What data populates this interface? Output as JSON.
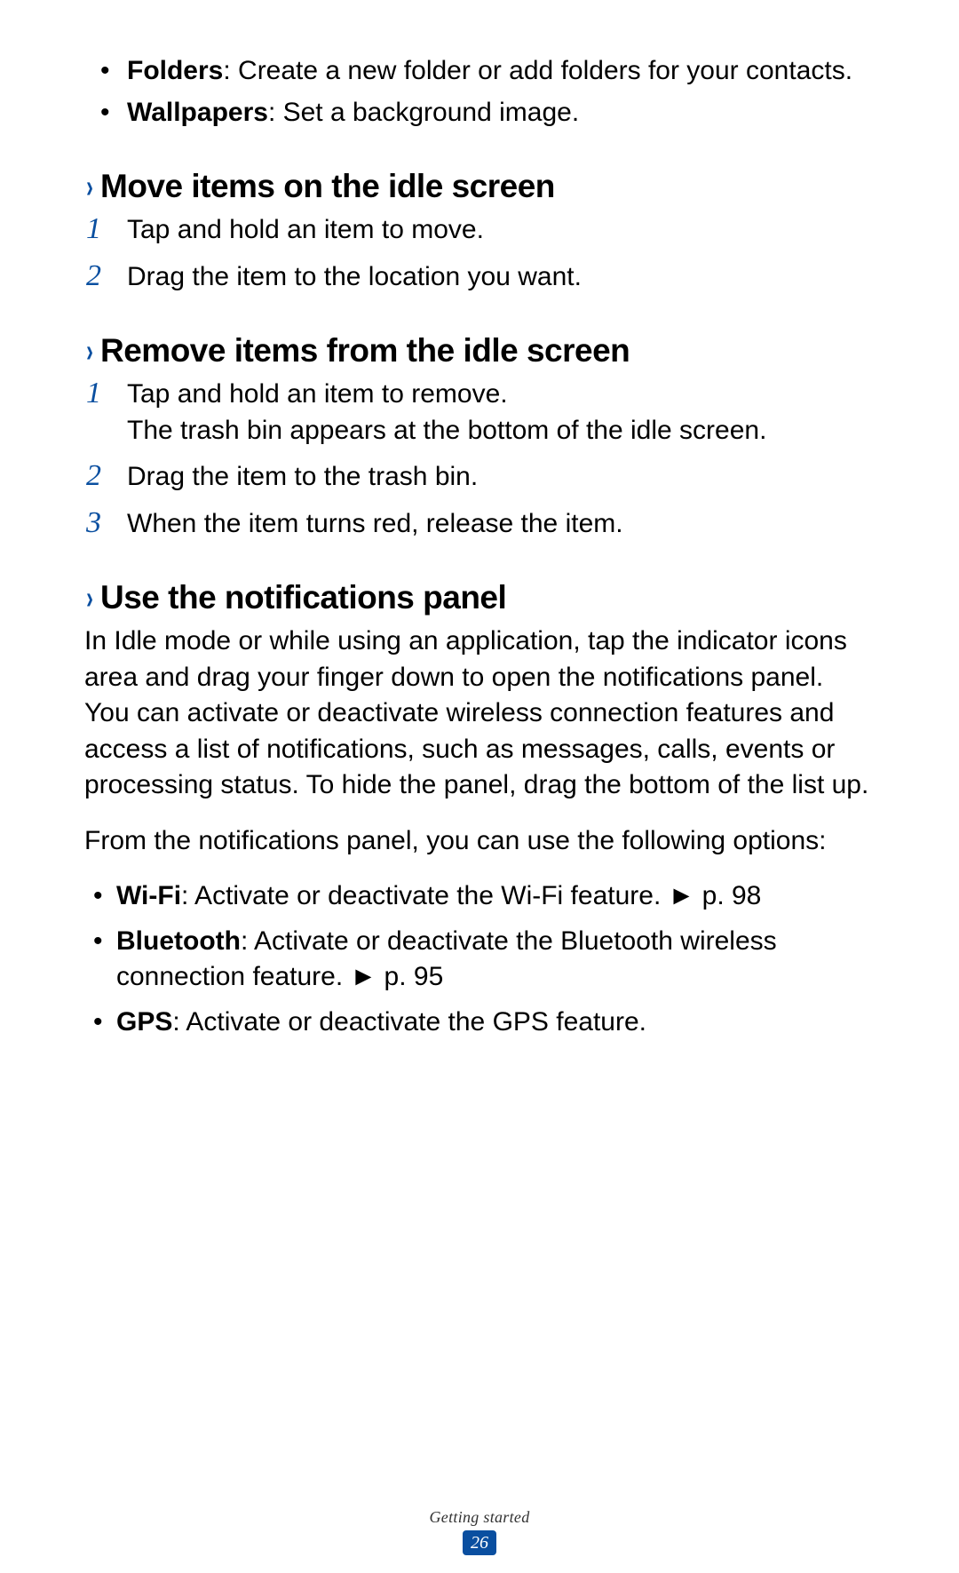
{
  "intro_bullets": [
    {
      "term": "Folders",
      "desc": ": Create a new folder or add folders for your contacts."
    },
    {
      "term": "Wallpapers",
      "desc": ": Set a background image."
    }
  ],
  "sections": {
    "move": {
      "heading": "Move items on the idle screen",
      "steps": [
        "Tap and hold an item to move.",
        "Drag the item to the location you want."
      ]
    },
    "remove": {
      "heading": "Remove items from the idle screen",
      "step1_line1": "Tap and hold an item to remove.",
      "step1_line2": "The trash bin appears at the bottom of the idle screen.",
      "step2": "Drag the item to the trash bin.",
      "step3": "When the item turns red, release the item."
    },
    "notifications": {
      "heading": "Use the notifications panel",
      "para1": "In Idle mode or while using an application, tap the indicator icons area and drag your finger down to open the notifications panel. You can activate or deactivate wireless connection features and access a list of notifications, such as messages, calls, events or processing status. To hide the panel, drag the bottom of the list up.",
      "para2": "From the notifications panel, you can use the following options:",
      "options": [
        {
          "term": "Wi-Fi",
          "desc": ": Activate or deactivate the Wi-Fi feature. ► p. 98"
        },
        {
          "term": "Bluetooth",
          "desc": ": Activate or deactivate the Bluetooth wireless connection feature. ► p. 95"
        },
        {
          "term": "GPS",
          "desc": ": Activate or deactivate the GPS feature."
        }
      ]
    }
  },
  "footer": {
    "label": "Getting started",
    "page": "26"
  }
}
